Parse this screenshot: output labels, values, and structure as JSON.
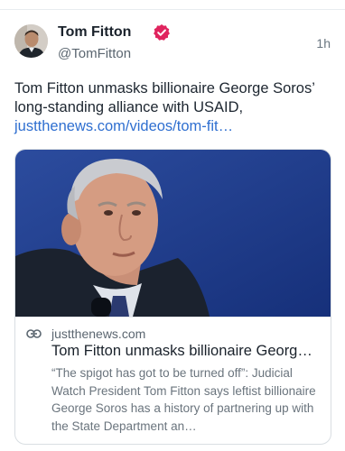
{
  "post": {
    "author_name": "Tom Fitton",
    "author_handle": "@TomFitton",
    "timestamp": "1h",
    "text": "Tom Fitton unmasks billionaire George Soros’ long-standing alliance with USAID,",
    "link_text": "justthenews.com/videos/tom-fit…"
  },
  "card": {
    "domain": "justthenews.com",
    "title": "Tom Fitton unmasks billionaire Georg…",
    "description": "“The spigot has got to be turned off”: Judicial Watch President Tom Fitton says leftist billionaire George Soros has a history of partnering up with the State Department an…"
  },
  "icons": {
    "verified": "verified-badge-icon",
    "link": "link-icon"
  },
  "colors": {
    "verified_badge": "#e0245e",
    "link": "#2f6fd0",
    "image_background": "#1f3f8e"
  }
}
